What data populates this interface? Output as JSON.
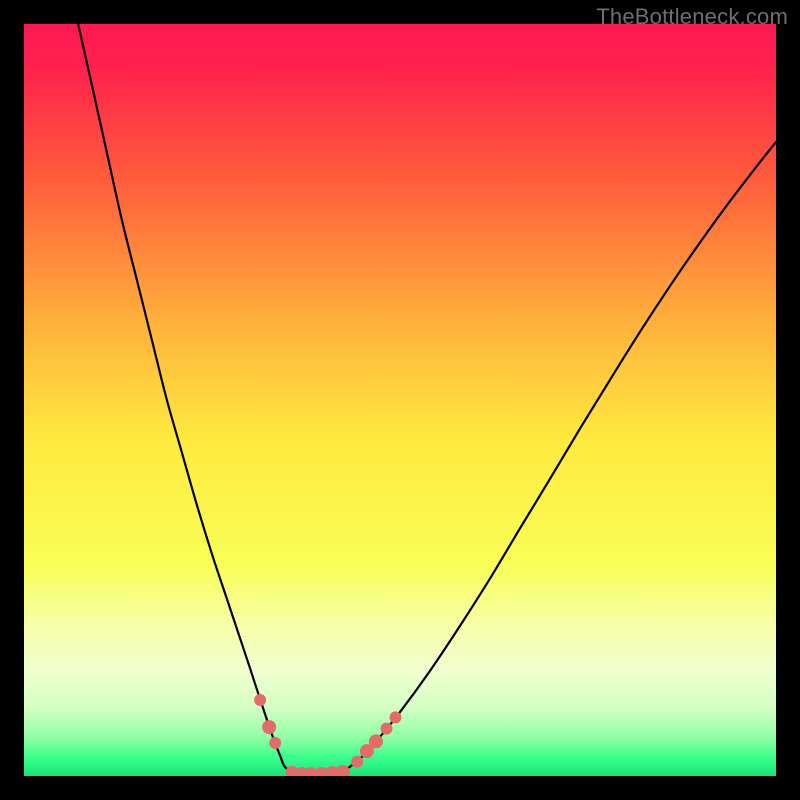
{
  "watermark": "TheBottleneck.com",
  "chart_data": {
    "type": "line",
    "title": "",
    "xlabel": "",
    "ylabel": "",
    "xlim": [
      0,
      100
    ],
    "ylim": [
      0,
      100
    ],
    "background_gradient": {
      "stops": [
        {
          "offset": 0.0,
          "color": "#ff1a52"
        },
        {
          "offset": 0.05,
          "color": "#ff1f4e"
        },
        {
          "offset": 0.2,
          "color": "#ff5a3c"
        },
        {
          "offset": 0.4,
          "color": "#ffb23c"
        },
        {
          "offset": 0.55,
          "color": "#ffe93e"
        },
        {
          "offset": 0.72,
          "color": "#f9ff57"
        },
        {
          "offset": 0.8,
          "color": "#f6ffa8"
        },
        {
          "offset": 0.86,
          "color": "#f1ffcf"
        },
        {
          "offset": 0.91,
          "color": "#d4ffc4"
        },
        {
          "offset": 0.95,
          "color": "#8dffa3"
        },
        {
          "offset": 0.975,
          "color": "#3cff8d"
        },
        {
          "offset": 1.0,
          "color": "#18e477"
        }
      ]
    },
    "series": [
      {
        "name": "left-curve",
        "x": [
          7.2,
          9,
          11,
          13,
          15,
          17,
          19,
          21,
          23,
          25,
          27,
          28.5,
          30,
          31.3,
          32.4,
          33.3,
          34.1,
          34.7
        ],
        "y": [
          100,
          92,
          83,
          74,
          66,
          58,
          50,
          43,
          36,
          29.5,
          23.5,
          19,
          14.5,
          10.5,
          7.2,
          4.6,
          2.6,
          1.2
        ]
      },
      {
        "name": "valley-floor",
        "x": [
          34.7,
          36,
          37.5,
          39,
          40.5,
          42,
          43.3
        ],
        "y": [
          1.2,
          0.45,
          0.18,
          0.1,
          0.18,
          0.45,
          1.2
        ]
      },
      {
        "name": "right-curve",
        "x": [
          43.3,
          45,
          47,
          50,
          54,
          58,
          62,
          66,
          70,
          74,
          78,
          82,
          86,
          90,
          94,
          98,
          100
        ],
        "y": [
          1.2,
          2.6,
          4.8,
          8.5,
          14,
          20,
          26.3,
          33,
          39.6,
          46.3,
          52.8,
          59.2,
          65.3,
          71.1,
          76.6,
          81.8,
          84.3
        ]
      }
    ],
    "markers": [
      {
        "x": 31.4,
        "y": 10.1,
        "r": 6
      },
      {
        "x": 32.6,
        "y": 6.5,
        "r": 7
      },
      {
        "x": 33.4,
        "y": 4.4,
        "r": 6
      },
      {
        "x": 35.6,
        "y": 0.55,
        "r": 6
      },
      {
        "x": 36.9,
        "y": 0.25,
        "r": 7
      },
      {
        "x": 38.2,
        "y": 0.12,
        "r": 8
      },
      {
        "x": 39.6,
        "y": 0.12,
        "r": 8
      },
      {
        "x": 41.0,
        "y": 0.25,
        "r": 8
      },
      {
        "x": 42.4,
        "y": 0.55,
        "r": 7
      },
      {
        "x": 44.3,
        "y": 1.9,
        "r": 6
      },
      {
        "x": 45.6,
        "y": 3.3,
        "r": 7
      },
      {
        "x": 46.8,
        "y": 4.6,
        "r": 7
      },
      {
        "x": 48.2,
        "y": 6.3,
        "r": 6
      },
      {
        "x": 49.4,
        "y": 7.8,
        "r": 6
      }
    ],
    "marker_style": {
      "fill": "#e56a6a",
      "stroke": "none"
    },
    "curve_style": {
      "stroke": "#000000",
      "width": 2.2
    }
  }
}
